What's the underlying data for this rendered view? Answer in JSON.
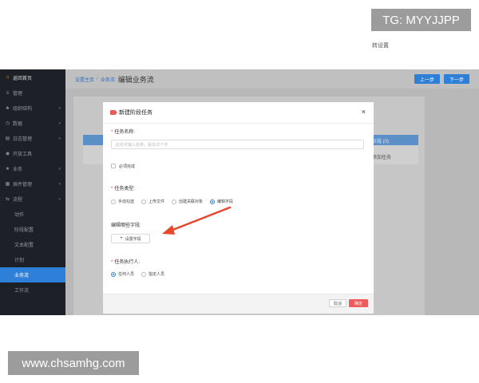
{
  "watermarks": {
    "telegram": "TG: MYYJJPP",
    "website": "www.chsamhg.com"
  },
  "sidebar": {
    "home": "返回首页",
    "items": [
      {
        "label": "管理",
        "sub": false,
        "active": false
      },
      {
        "label": "组织结构",
        "sub": false,
        "active": false
      },
      {
        "label": "数据",
        "sub": false,
        "active": false
      },
      {
        "label": "日志管理",
        "sub": false,
        "active": false
      },
      {
        "label": "开放工具",
        "sub": false,
        "active": false
      },
      {
        "label": "业务",
        "sub": false,
        "active": false
      },
      {
        "label": "插件管理",
        "sub": false,
        "active": false
      },
      {
        "label": "流程",
        "sub": false,
        "active": false
      },
      {
        "label": "动作",
        "sub": true,
        "active": false
      },
      {
        "label": "阶段配置",
        "sub": true,
        "active": false
      },
      {
        "label": "文本配置",
        "sub": true,
        "active": false
      },
      {
        "label": "计划",
        "sub": true,
        "active": false
      },
      {
        "label": "业务流",
        "sub": true,
        "active": true
      },
      {
        "label": "工作流",
        "sub": true,
        "active": false
      }
    ]
  },
  "topbar": {
    "crumb_home": "设置主页",
    "crumb_sep": "/",
    "crumb_section": "业务流",
    "title": "编辑业务流",
    "prev_label": "上一步",
    "next_label": "下一步"
  },
  "background": {
    "tab_label": "转设置",
    "header_label": "阶段 (0)",
    "row_label": "添加任务"
  },
  "modal": {
    "title": "新建阶段任务",
    "close": "×",
    "required_mark": "*",
    "name_label": "任务名称:",
    "name_placeholder": "此处可输入名称，最多20个字",
    "must_complete": "必须完成",
    "type_label": "任务类型:",
    "type_options": [
      {
        "label": "手动勾选",
        "selected": false
      },
      {
        "label": "上传文件",
        "selected": false
      },
      {
        "label": "创建关联对象",
        "selected": false
      },
      {
        "label": "编辑字段",
        "selected": true
      }
    ],
    "field_label": "编辑哪些字段:",
    "add_field_plus": "+",
    "add_field_label": "设置字段",
    "executor_label": "任务执行人:",
    "executor_options": [
      {
        "label": "任何人员",
        "selected": true
      },
      {
        "label": "指定人员",
        "selected": false
      }
    ],
    "cancel_label": "取消",
    "ok_label": "确定"
  },
  "colors": {
    "sidebar_bg": "#1d2026",
    "accent_blue": "#2d7fd8",
    "danger_red": "#ef5a5a",
    "arrow": "#e8472e"
  }
}
